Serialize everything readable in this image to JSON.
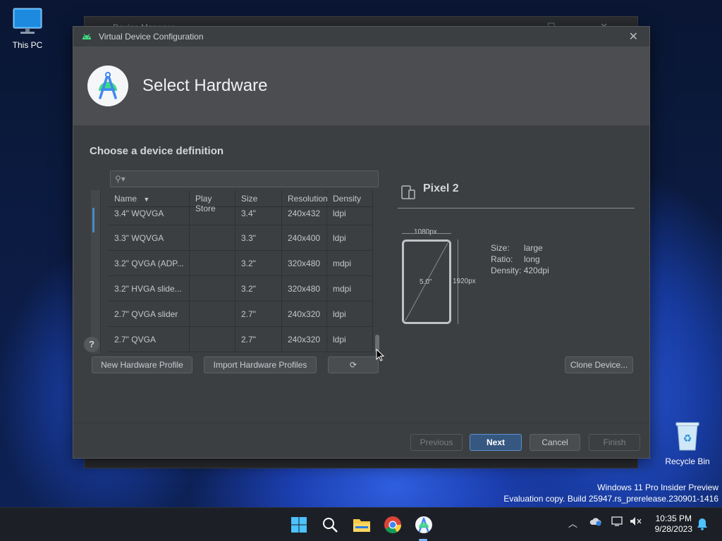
{
  "desktop": {
    "this_pc": "This PC",
    "recycle_bin": "Recycle Bin",
    "watermark_line1": "Windows 11 Pro Insider Preview",
    "watermark_line2": "Evaluation copy. Build 25947.rs_prerelease.230901-1416"
  },
  "background_window": {
    "title": "Device Manager"
  },
  "dialog": {
    "title": "Virtual Device Configuration",
    "header_title": "Select Hardware",
    "section_title": "Choose a device definition",
    "search_placeholder": ""
  },
  "table": {
    "headers": {
      "name": "Name",
      "play_store": "Play Store",
      "size": "Size",
      "resolution": "Resolution",
      "density": "Density"
    },
    "sort_icon": "sort-desc-icon",
    "rows": [
      {
        "name": "3.4\" WQVGA",
        "play_store": "",
        "size": "3.4\"",
        "resolution": "240x432",
        "density": "ldpi"
      },
      {
        "name": "3.3\" WQVGA",
        "play_store": "",
        "size": "3.3\"",
        "resolution": "240x400",
        "density": "ldpi"
      },
      {
        "name": "3.2\" QVGA (ADP...",
        "play_store": "",
        "size": "3.2\"",
        "resolution": "320x480",
        "density": "mdpi"
      },
      {
        "name": "3.2\" HVGA slide...",
        "play_store": "",
        "size": "3.2\"",
        "resolution": "320x480",
        "density": "mdpi"
      },
      {
        "name": "2.7\" QVGA slider",
        "play_store": "",
        "size": "2.7\"",
        "resolution": "240x320",
        "density": "ldpi"
      },
      {
        "name": "2.7\" QVGA",
        "play_store": "",
        "size": "2.7\"",
        "resolution": "240x320",
        "density": "ldpi"
      }
    ]
  },
  "buttons": {
    "new_profile": "New Hardware Profile",
    "import_profiles": "Import Hardware Profiles",
    "refresh_icon": "refresh-icon",
    "clone_device": "Clone Device...",
    "previous": "Previous",
    "next": "Next",
    "cancel": "Cancel",
    "finish": "Finish",
    "help": "?"
  },
  "preview": {
    "device_name": "Pixel 2",
    "width_px": "1080px",
    "height_px": "1920px",
    "diagonal": "5.0\"",
    "size_label": "Size:",
    "size_value": "large",
    "ratio_label": "Ratio:",
    "ratio_value": "long",
    "density_label": "Density:",
    "density_value": "420dpi"
  },
  "taskbar": {
    "time": "10:35 PM",
    "date": "9/28/2023"
  },
  "colors": {
    "dialog_bg": "#3c3f41",
    "header_bg": "#4b4d50",
    "primary_button": "#365880",
    "accent": "#4a88c7"
  }
}
